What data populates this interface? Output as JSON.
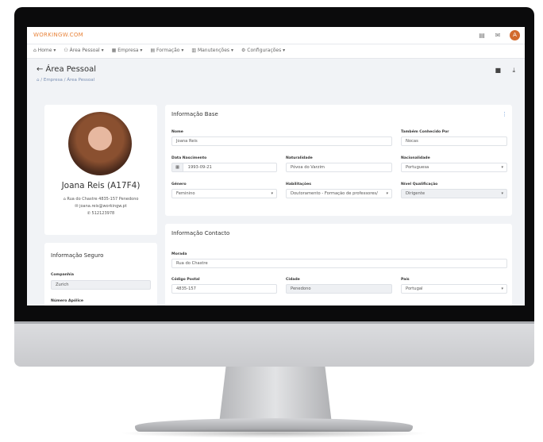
{
  "app": {
    "brand": "WORKINGW.COM"
  },
  "topbar_icons": {
    "calendar": "▤",
    "mail": "✉",
    "avatar_letter": "A"
  },
  "menu": {
    "items": [
      "⌂ Home ▾",
      "⚇ Área Pessoal ▾",
      "▦ Empresa ▾",
      "▤ Formação ▾",
      "▥ Manutenções ▾",
      "⚙ Configurações ▾"
    ]
  },
  "page": {
    "title": "← Área Pessoal",
    "breadcrumb": "⌂ / Empresa / Área Pessoal",
    "save_icon": "■",
    "download_icon": "⤓"
  },
  "profile": {
    "name": "Joana Reis (A17F4)",
    "address": "⌂ Rua do Chastre 4835-157 Penedono",
    "email": "✉ joana.reis@workingw.pt",
    "phone": "✆ 512123978"
  },
  "seguro": {
    "title": "Informação Seguro",
    "company_label": "Companhia",
    "company_value": "Zurich",
    "policy_label": "Número Apólice"
  },
  "base_info": {
    "title": "Informação Base",
    "menu_icon": "⋮",
    "name_label": "Nome",
    "name_value": "Joana Reis",
    "alias_label": "Também Conhecido Por",
    "alias_value": "Nocas",
    "birth_label": "Data Nascimento",
    "birth_value": "1993-09-21",
    "birth_icon": "▦",
    "hometown_label": "Naturalidade",
    "hometown_value": "Póvoa do Varzim",
    "nationality_label": "Nacionalidade",
    "nationality_value": "Portuguesa",
    "gender_label": "Género",
    "gender_value": "Feminino",
    "education_label": "Habilitações",
    "education_value": "Doutoramento - Formação de professores/",
    "qualification_label": "Nível Qualificação",
    "qualification_value": "Dirigente"
  },
  "contact_info": {
    "title": "Informação Contacto",
    "street_label": "Morada",
    "street_value": "Rua do Chastre",
    "postal_label": "Código Postal",
    "postal_value": "4835-157",
    "city_label": "Cidade",
    "city_value": "Penedono",
    "country_label": "País",
    "country_value": "Portugal"
  },
  "caret": "▾"
}
